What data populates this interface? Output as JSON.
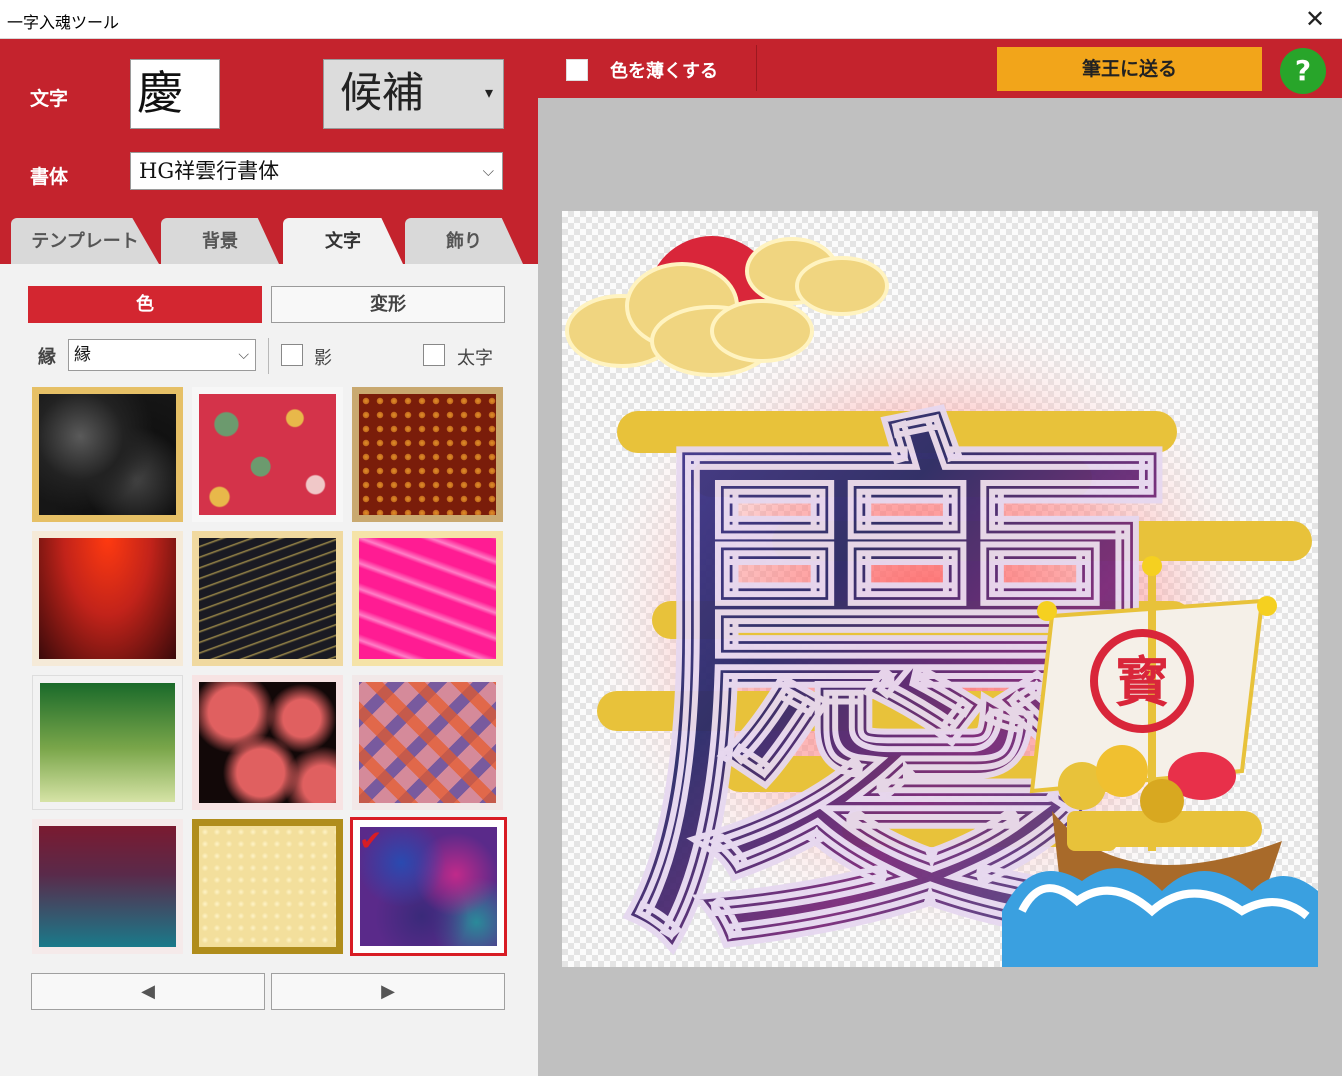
{
  "window": {
    "title": "一字入魂ツール",
    "close_icon": "close-icon"
  },
  "left": {
    "char_label": "文字",
    "char_value": "慶",
    "candidates_label": "候補",
    "candidates_arrow": "▾",
    "font_label": "書体",
    "font_value": "HG祥雲行書体",
    "font_chev": "⌵",
    "tabs": [
      {
        "label": "テンプレート",
        "active": false
      },
      {
        "label": "背景",
        "active": false
      },
      {
        "label": "文字",
        "active": true
      },
      {
        "label": "飾り",
        "active": false
      }
    ],
    "segments": [
      {
        "label": "色",
        "active": true
      },
      {
        "label": "変形",
        "active": false
      }
    ],
    "edge_label": "縁",
    "edge_value": "縁",
    "edge_chev": "⌵",
    "shadow_label": "影",
    "bold_label": "太字",
    "swatches": [
      {
        "name": "black-smoke",
        "selected": false
      },
      {
        "name": "red-pine-pattern",
        "selected": false
      },
      {
        "name": "brown-flower-pattern",
        "selected": false
      },
      {
        "name": "red-black-gradient",
        "selected": false
      },
      {
        "name": "black-gold-waves",
        "selected": false
      },
      {
        "name": "pink-marble",
        "selected": false
      },
      {
        "name": "green-gradient",
        "selected": false
      },
      {
        "name": "pink-black-blotch",
        "selected": false
      },
      {
        "name": "plaid-pattern",
        "selected": false
      },
      {
        "name": "maroon-teal-gradient",
        "selected": false
      },
      {
        "name": "gold-paper",
        "selected": false
      },
      {
        "name": "purple-watercolor",
        "selected": true
      }
    ],
    "prev_icon": "◀",
    "next_icon": "▶"
  },
  "right": {
    "fade_label": "色を薄くする",
    "send_label": "筆王に送る",
    "help_label": "?"
  },
  "preview": {
    "character": "慶",
    "seal_text": "寳",
    "colors": {
      "sun": "#d9263a",
      "gold": "#e8c23a",
      "cloud": "#f0d580",
      "wave": "#2a8fd0"
    }
  }
}
